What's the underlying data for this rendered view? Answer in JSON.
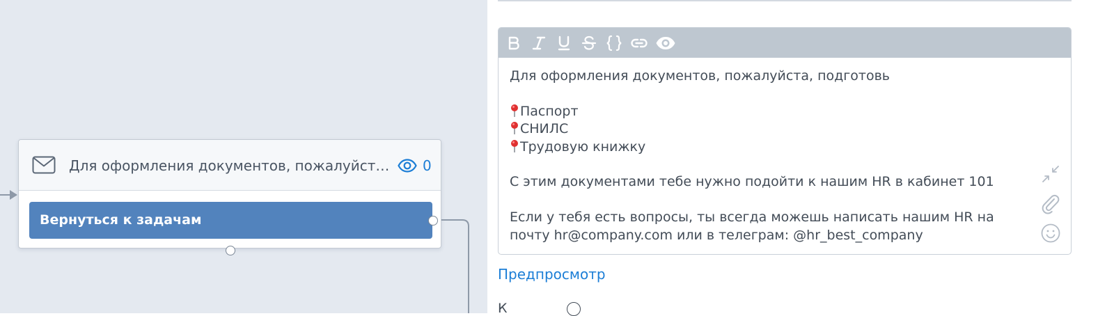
{
  "node": {
    "title": "Для оформления документов, пожалуйста, подготовь",
    "views_count": "0",
    "button_label": "Вернуться к задачам",
    "icon": "mail-icon",
    "views_icon": "eye-icon"
  },
  "editor": {
    "toolbar": [
      {
        "name": "bold",
        "icon": "bold-icon"
      },
      {
        "name": "italic",
        "icon": "italic-icon"
      },
      {
        "name": "underline",
        "icon": "underline-icon"
      },
      {
        "name": "strikethrough",
        "icon": "strikethrough-icon"
      },
      {
        "name": "code",
        "icon": "code-braces-icon"
      },
      {
        "name": "link",
        "icon": "link-icon"
      },
      {
        "name": "preview",
        "icon": "eye-icon"
      }
    ],
    "lines": {
      "l1": "Для оформления документов, пожалуйста, подготовь",
      "l2": "Паспорт",
      "l3": "СНИЛС",
      "l4": "Трудовую книжку",
      "l5": "С этим документами тебе нужно подойти к нашим HR в кабинет 101",
      "l6": "Если у тебя есть вопросы, ты всегда можешь написать нашим HR на",
      "l7": "почту hr@company.com или в телеграм: @hr_best_company"
    },
    "bullet_icon": "pushpin-icon",
    "side_tools": [
      "collapse-icon",
      "paperclip-icon",
      "emoji-icon"
    ]
  },
  "preview_link": "Предпросмотр",
  "bottom_cut_text": "К",
  "colors": {
    "canvas_bg": "#e4e9f0",
    "button_blue": "#5283bd",
    "link_blue": "#1c7ed6",
    "toolbar_bg": "#bec7d0"
  }
}
